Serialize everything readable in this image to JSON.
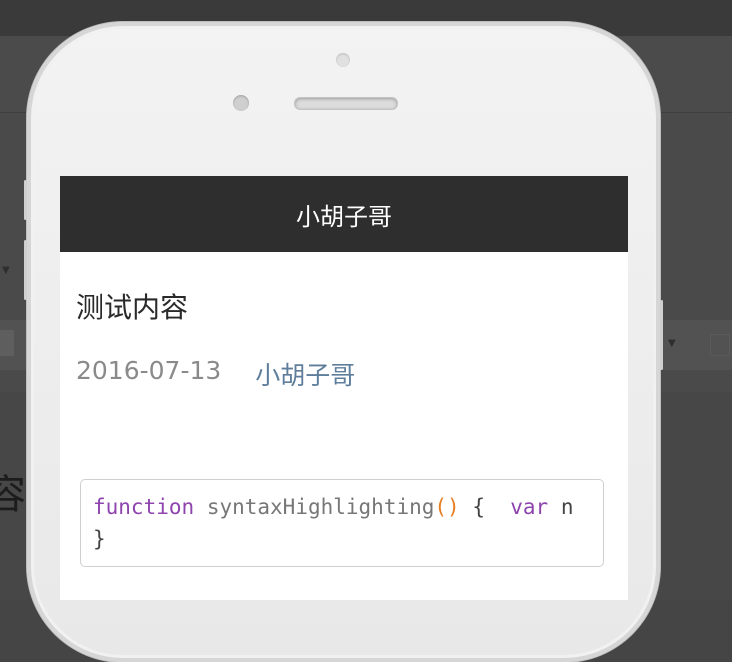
{
  "app": {
    "nav_title": "小胡子哥"
  },
  "post": {
    "title": "测试内容",
    "date": "2016-07-13",
    "author": "小胡子哥"
  },
  "code_block": {
    "keyword_function": "function",
    "function_name": "syntaxHighlighting",
    "parens": "()",
    "open_brace": " {  ",
    "keyword_var": "var",
    "var_rest": " n",
    "close_brace": "}"
  },
  "background": {
    "partial_char": "容"
  },
  "colors": {
    "navbar": "#2e2e2e",
    "author_link": "#5f7e9b",
    "keyword": "#8e44ad",
    "paren": "#e67e22"
  }
}
